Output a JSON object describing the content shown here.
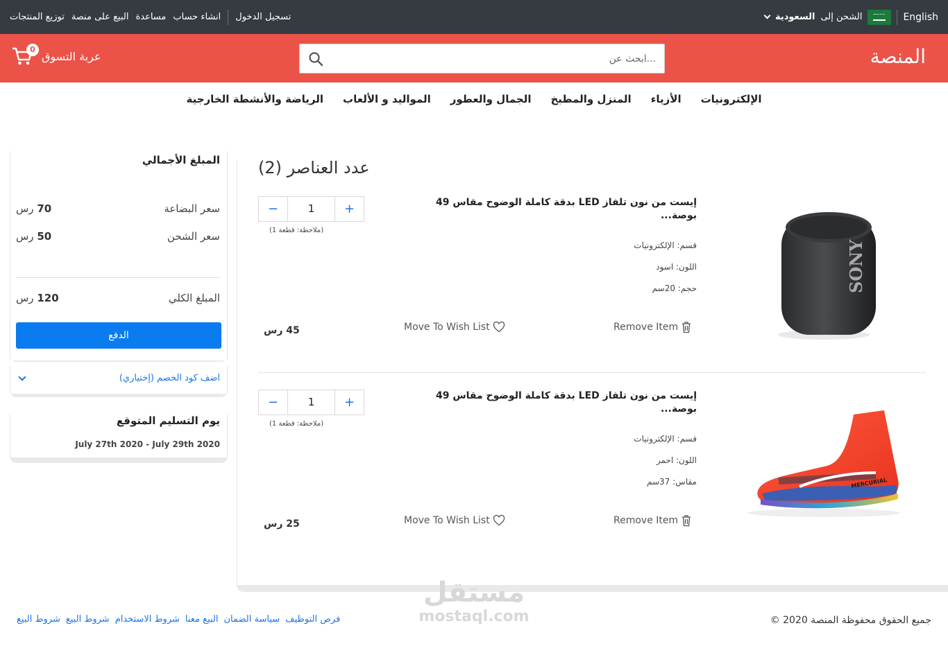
{
  "topbar": {
    "links": [
      "توزيع المنتجات",
      "البيع على منصة",
      "مساعدة",
      "انشاء حساب"
    ],
    "login": "تسجيل الدخول",
    "language": "English",
    "ship_prefix": "الشحن إلى",
    "ship_country": "السعودية"
  },
  "header": {
    "logo": "المنصة",
    "search_placeholder": "ابحث عن...",
    "cart_label": "عربة التسوق",
    "cart_count": "0"
  },
  "categories": [
    "الإلكترونيات",
    "الأزياء",
    "المنزل والمطبخ",
    "الجمال والعطور",
    "المواليد و الألعاب",
    "الرياضة والأنشطة الخارجية"
  ],
  "cart": {
    "items_title": "عدد العناصر (2)",
    "items": [
      {
        "title": "إيست من نون تلفاز LED بدقة كاملة الوضوح مقاس 49 بوصة...",
        "category": "قسم: الإلكترونيات",
        "color": "اللون: اسود",
        "size": "حجم: 20سم",
        "qty": "1",
        "note": "(ملاحظة: قطعة 1)",
        "price": "45 رس",
        "wish_label": "Move To Wish List",
        "remove_label": "Remove Item",
        "image": "sony-speaker"
      },
      {
        "title": "إيست من نون تلفاز LED بدقة كاملة الوضوح مقاس 49 بوصة...",
        "category": "قسم: الإلكترونيات",
        "color": "اللون: احمر",
        "size": "مقاس: 37سم",
        "qty": "1",
        "note": "(ملاحظة: قطعة 1)",
        "price": "25 رس",
        "wish_label": "Move To Wish List",
        "remove_label": "Remove Item",
        "image": "football-boot"
      }
    ]
  },
  "summary": {
    "title": "المبلغ الأجمالي",
    "goods_label": "سعر البضاعة",
    "goods_value": "70",
    "shipping_label": "سعر الشحن",
    "shipping_value": "50",
    "total_label": "المبلغ الكلي",
    "total_value": "120",
    "currency": "رس",
    "pay_label": "الدفع"
  },
  "coupon": {
    "label": "اضف كود الخصم (إختياري)"
  },
  "delivery": {
    "title": "يوم التسليم المتوقع",
    "dates": "July 27th 2020 - July 29th 2020"
  },
  "footer": {
    "links": [
      "فرص التوظيف",
      "سياسة الضمان",
      "البيع معنا",
      "شروط الاستخدام",
      "شروط البيع",
      "شروط البيع"
    ],
    "copyright": "جميع الحقوق محفوظة المنصة 2020 ©"
  },
  "watermark": {
    "ar": "مستقل",
    "en": "mostaql.com"
  },
  "colors": {
    "topbar": "#363b41",
    "header": "#ec5348",
    "accent": "#0a7cf0",
    "link": "#1a73e8"
  }
}
